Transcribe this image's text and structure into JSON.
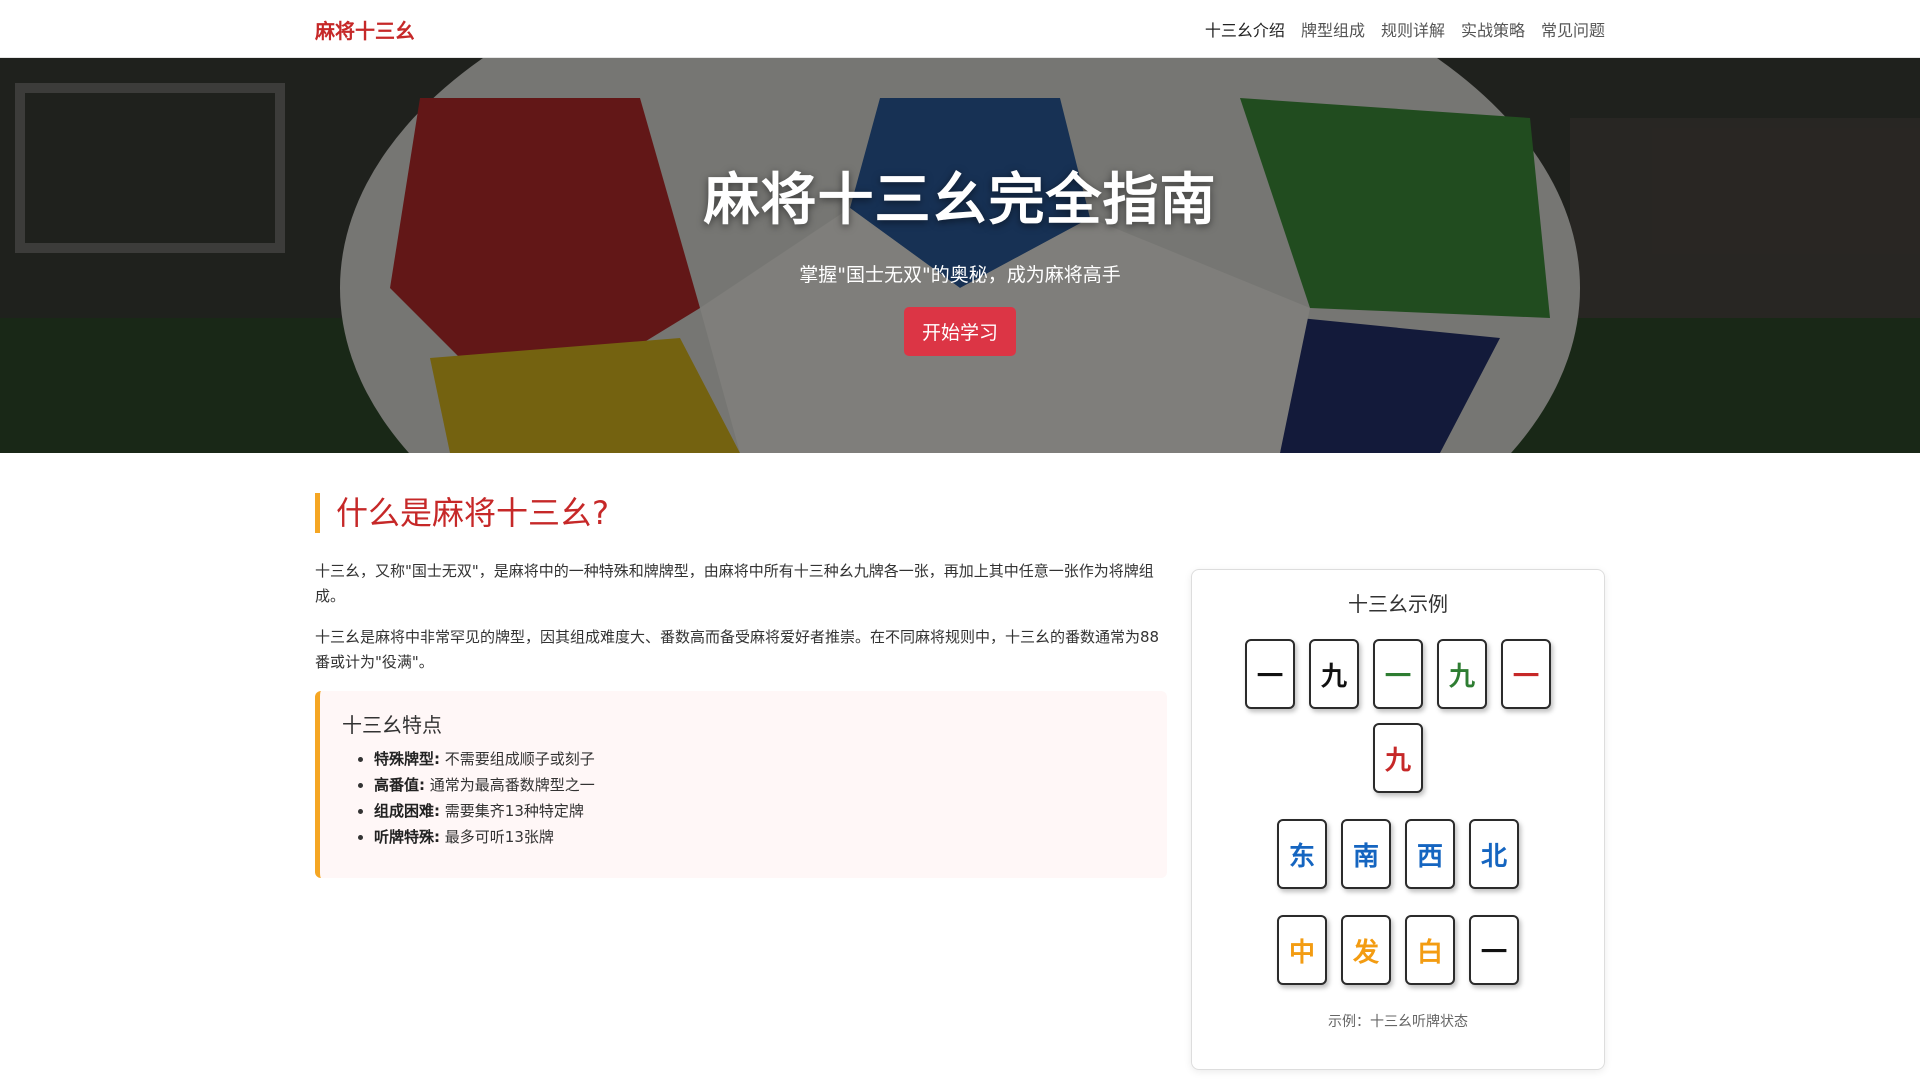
{
  "nav": {
    "brand": "麻将十三幺",
    "links": [
      "十三幺介绍",
      "牌型组成",
      "规则详解",
      "实战策略",
      "常见问题"
    ]
  },
  "hero": {
    "title": "麻将十三幺完全指南",
    "subtitle": "掌握\"国士无双\"的奥秘，成为麻将高手",
    "cta": "开始学习"
  },
  "section": {
    "title": "什么是麻将十三幺?",
    "para1": "十三幺，又称\"国士无双\"，是麻将中的一种特殊和牌牌型，由麻将中所有十三种幺九牌各一张，再加上其中任意一张作为将牌组成。",
    "para2": "十三幺是麻将中非常罕见的牌型，因其组成难度大、番数高而备受麻将爱好者推崇。在不同麻将规则中，十三幺的番数通常为88番或计为\"役满\"。"
  },
  "features": {
    "title": "十三幺特点",
    "items": [
      {
        "label": "特殊牌型:",
        "text": "不需要组成顺子或刻子"
      },
      {
        "label": "高番值:",
        "text": "通常为最高番数牌型之一"
      },
      {
        "label": "组成困难:",
        "text": "需要集齐13种特定牌"
      },
      {
        "label": "听牌特殊:",
        "text": "最多可听13张牌"
      }
    ]
  },
  "example": {
    "title": "十三幺示例",
    "caption": "示例：十三幺听牌状态",
    "tiles_row1": [
      {
        "char": "一",
        "color": "#111111"
      },
      {
        "char": "九",
        "color": "#111111"
      },
      {
        "char": "一",
        "color": "#2e7d32"
      },
      {
        "char": "九",
        "color": "#2e7d32"
      },
      {
        "char": "一",
        "color": "#c62828"
      },
      {
        "char": "九",
        "color": "#c62828"
      }
    ],
    "tiles_row2": [
      {
        "char": "东",
        "color": "#1565c0"
      },
      {
        "char": "南",
        "color": "#1565c0"
      },
      {
        "char": "西",
        "color": "#1565c0"
      },
      {
        "char": "北",
        "color": "#1565c0"
      }
    ],
    "tiles_row3": [
      {
        "char": "中",
        "color": "#f39c12"
      },
      {
        "char": "发",
        "color": "#f39c12"
      },
      {
        "char": "白",
        "color": "#f39c12"
      },
      {
        "char": "一",
        "color": "#111111"
      }
    ]
  },
  "colors": {
    "brand_red": "#c62828",
    "accent_orange": "#f5a623",
    "cta_red": "#dc3545"
  }
}
